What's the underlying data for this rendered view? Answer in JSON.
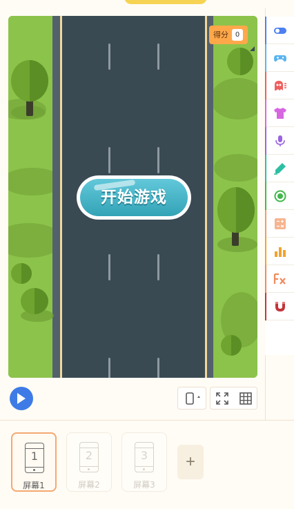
{
  "game": {
    "start_label": "开始游戏",
    "score_label": "得分",
    "score_value": "0"
  },
  "toolbar": {
    "play_icon": "play-icon",
    "device_icon": "phone-rotate-icon",
    "fullscreen_icon": "fullscreen-icon",
    "grid_icon": "grid-icon"
  },
  "categories": [
    {
      "icon": "toggle-icon",
      "color": "#4c7ff0"
    },
    {
      "icon": "gamepad-icon",
      "color": "#5ab4f0"
    },
    {
      "icon": "ghost-icon",
      "color": "#ef5e5e"
    },
    {
      "icon": "tshirt-icon",
      "color": "#d767e0"
    },
    {
      "icon": "microphone-icon",
      "color": "#9a63e2"
    },
    {
      "icon": "pen-icon",
      "color": "#2cbfa3"
    },
    {
      "icon": "target-icon",
      "color": "#41b84a"
    },
    {
      "icon": "calculator-icon",
      "color": "#f09a6a"
    },
    {
      "icon": "bar-chart-icon",
      "color": "#f4a22d"
    },
    {
      "icon": "function-icon",
      "color": "#f08a5d"
    },
    {
      "icon": "magnet-icon",
      "color": "#c0353a"
    }
  ],
  "screens": [
    {
      "number": "1",
      "label": "屏幕1",
      "active": true
    },
    {
      "number": "2",
      "label": "屏幕2",
      "active": false
    },
    {
      "number": "3",
      "label": "屏幕3",
      "active": false
    }
  ],
  "add_screen_label": "+",
  "colors": {
    "accent": "#3e7be6",
    "road": "#3a4a53",
    "grass": "#8cc34b",
    "score_bg": "#ffa84a",
    "active_card_border": "#f3a871"
  }
}
